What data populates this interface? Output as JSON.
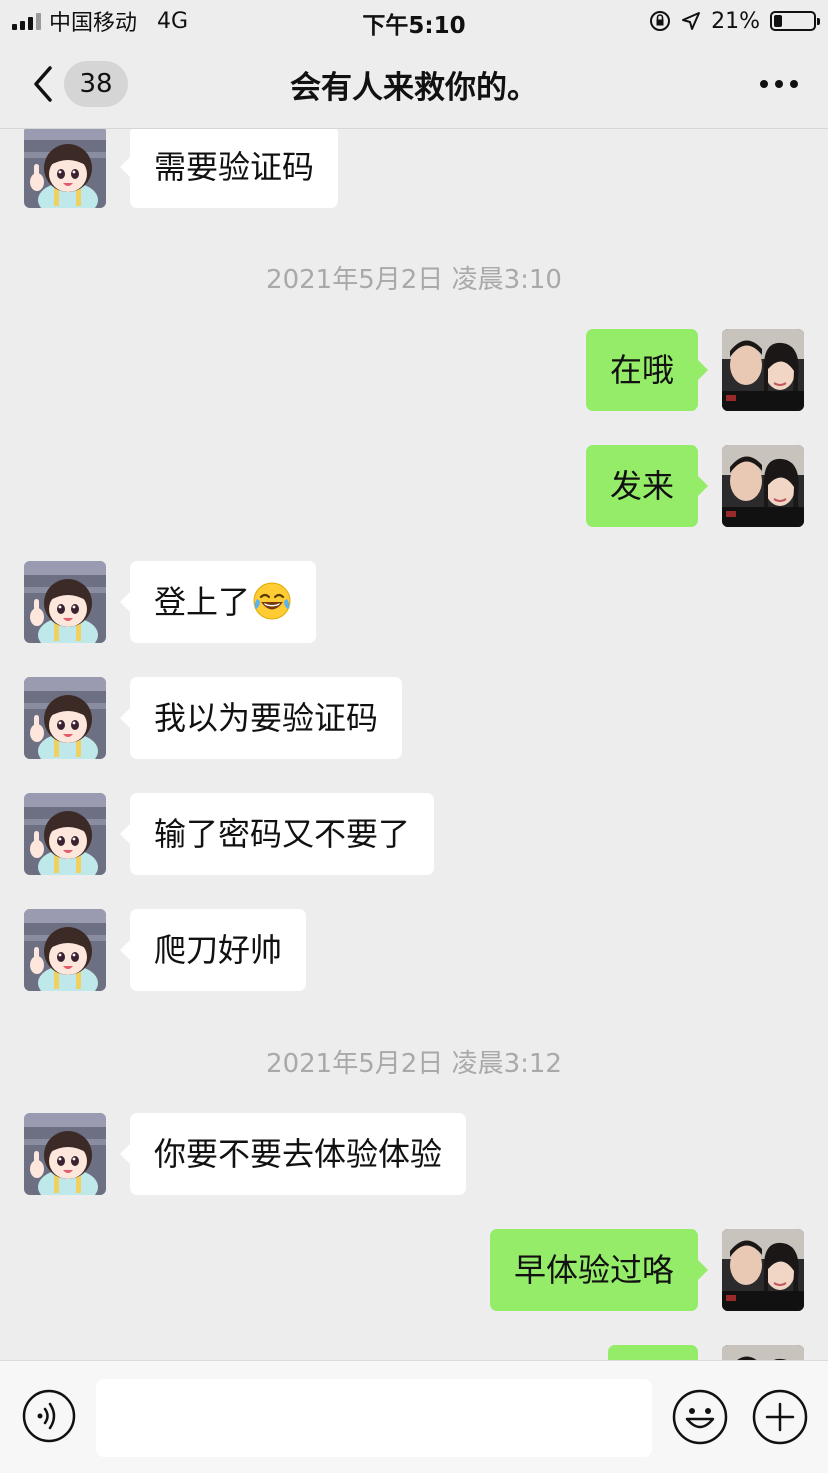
{
  "status_bar": {
    "carrier": "中国移动",
    "network": "4G",
    "time": "下午5:10",
    "battery": "21%",
    "battery_level": 0.21
  },
  "nav": {
    "back_count": "38",
    "title": "会有人来救你的。"
  },
  "messages": [
    {
      "side": "in",
      "text": "需要验证码"
    },
    {
      "type": "time",
      "text": "2021年5月2日 凌晨3:10"
    },
    {
      "side": "out",
      "text": "在哦"
    },
    {
      "side": "out",
      "text": "发来"
    },
    {
      "side": "in",
      "text": "登上了",
      "emoji": "laughing-tears-emoji"
    },
    {
      "side": "in",
      "text": "我以为要验证码"
    },
    {
      "side": "in",
      "text": "输了密码又不要了"
    },
    {
      "side": "in",
      "text": "爬刀好帅"
    },
    {
      "type": "time",
      "text": "2021年5月2日 凌晨3:12"
    },
    {
      "side": "in",
      "text": "你要不要去体验体验"
    },
    {
      "side": "out",
      "text": "早体验过咯"
    },
    {
      "side": "out",
      "text": ""
    }
  ],
  "input_bar": {
    "icons": [
      "voice-icon",
      "emoji-icon",
      "plus-icon"
    ]
  },
  "colors": {
    "background": "#ededed",
    "outgoing_bubble": "#95ec69",
    "incoming_bubble": "#ffffff"
  }
}
